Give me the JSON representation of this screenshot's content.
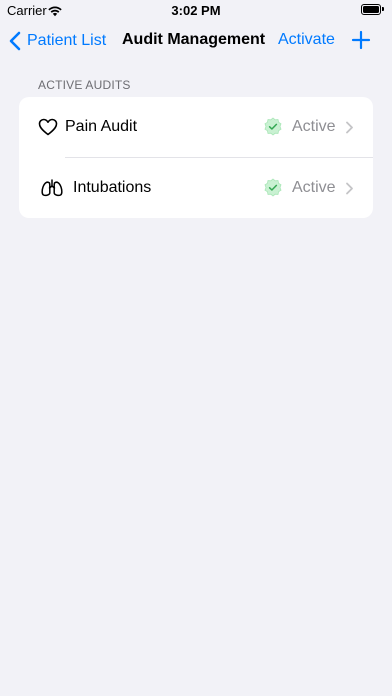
{
  "status_bar": {
    "carrier": "Carrier",
    "time": "3:02 PM"
  },
  "nav": {
    "back_label": "Patient List",
    "title": "Audit Management",
    "activate_label": "Activate",
    "add_icon": "plus-icon"
  },
  "section": {
    "header": "ACTIVE AUDITS"
  },
  "audits": [
    {
      "icon": "heart-icon",
      "label": "Pain Audit",
      "status": "Active"
    },
    {
      "icon": "lungs-icon",
      "label": "Intubations",
      "status": "Active"
    }
  ],
  "colors": {
    "accent": "#007aff",
    "background": "#f2f2f7",
    "status_check": "#34c759",
    "secondary_text": "#8e8e93"
  }
}
